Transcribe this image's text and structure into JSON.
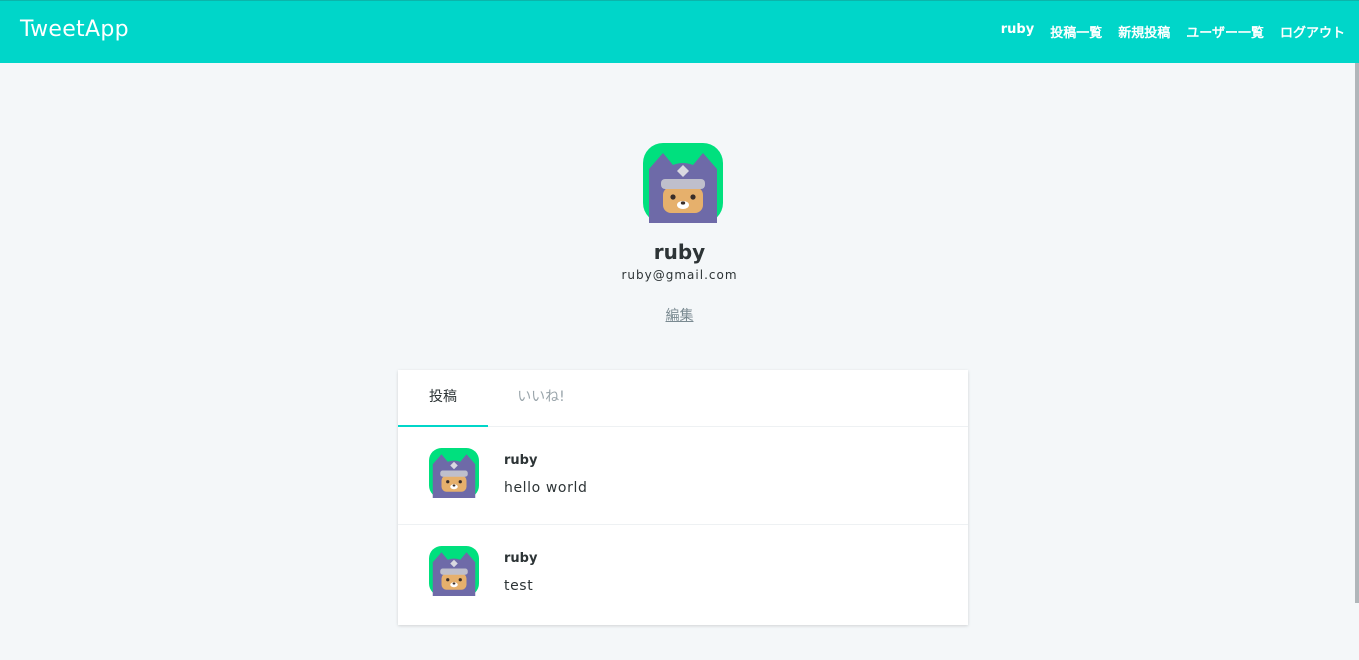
{
  "header": {
    "logo": "TweetApp",
    "nav": {
      "current_user": "ruby",
      "posts": "投稿一覧",
      "new_post": "新規投稿",
      "users": "ユーザー一覧",
      "logout": "ログアウト"
    }
  },
  "profile": {
    "name": "ruby",
    "email": "ruby@gmail.com",
    "edit_label": "編集",
    "avatar_icon": "ninja-cat-avatar-icon"
  },
  "tabs": [
    {
      "label": "投稿",
      "active": true
    },
    {
      "label": "いいね!",
      "active": false
    }
  ],
  "posts": [
    {
      "user": "ruby",
      "content": "hello world"
    },
    {
      "user": "ruby",
      "content": "test"
    }
  ],
  "colors": {
    "brand": "#00d6c9",
    "avatar_bg": "#00e07e",
    "avatar_hood": "#6e6aa8",
    "avatar_face": "#e6b06c"
  }
}
